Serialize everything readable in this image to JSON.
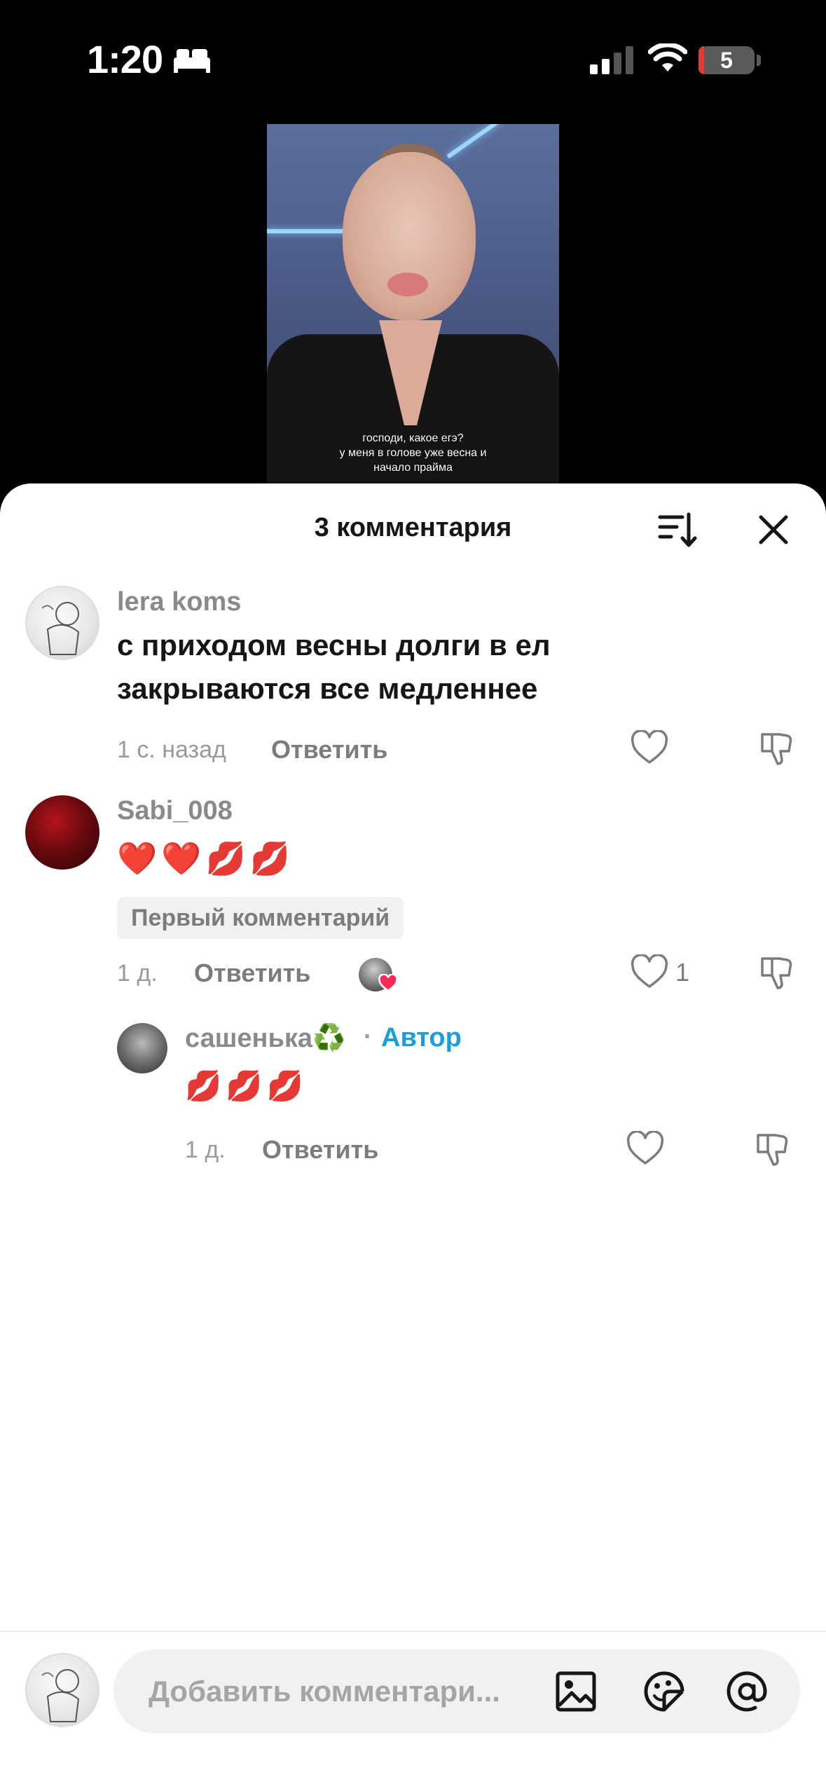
{
  "status_bar": {
    "time": "1:20",
    "battery": "5"
  },
  "video": {
    "subtitle_lines": [
      "господи, какое егэ?",
      "у меня в голове уже весна и",
      "начало прайма"
    ]
  },
  "sheet": {
    "title": "3 комментария"
  },
  "comments": [
    {
      "username": "lera koms",
      "text_lines": [
        "с приходом весны долги в ел",
        "закрываются все медленнее"
      ],
      "time": "1 с. назад",
      "reply_label": "Ответить"
    },
    {
      "username": "Sabi_008",
      "text": "❤️❤️💋💋",
      "badge": "Первый комментарий",
      "time": "1 д.",
      "reply_label": "Ответить",
      "like_count": "1"
    },
    {
      "username": "сашенька♻️",
      "author_sep": "·",
      "author_label": "Автор",
      "text": "💋💋💋",
      "time": "1 д.",
      "reply_label": "Ответить"
    }
  ],
  "composer": {
    "placeholder": "Добавить комментари..."
  },
  "colors": {
    "accent_author": "#1b9fd8",
    "like_heart": "#fe2c55"
  },
  "icons": [
    "bed-icon",
    "signal-icon",
    "wifi-icon",
    "sort-icon",
    "close-icon",
    "heart-icon",
    "dislike-icon",
    "image-icon",
    "sticker-icon",
    "mention-icon"
  ]
}
